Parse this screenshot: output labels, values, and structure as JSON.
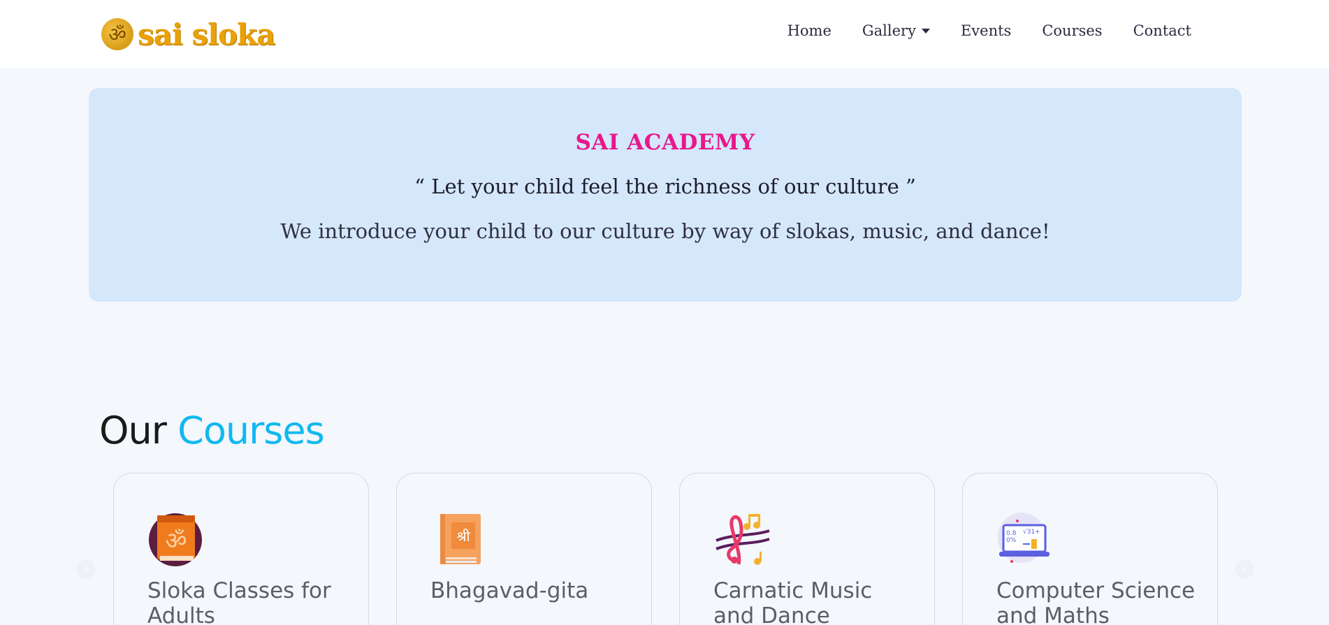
{
  "navbar": {
    "logo_text": "sai sloka",
    "logo_glyph": "ॐ",
    "links": [
      {
        "label": "Home"
      },
      {
        "label": "Gallery",
        "dropdown": true
      },
      {
        "label": "Events"
      },
      {
        "label": "Courses"
      },
      {
        "label": "Contact"
      }
    ]
  },
  "hero": {
    "title": "SAI ACADEMY",
    "quote": "“ Let your child feel the richness of our culture ”",
    "subtitle": "We introduce your child to our culture by way of slokas, music, and dance!"
  },
  "courses": {
    "heading_prefix": "Our",
    "heading_accent": "Courses",
    "items": [
      {
        "title": "Sloka Classes for Adults",
        "icon": "om-book-icon"
      },
      {
        "title": "Bhagavad-gita",
        "icon": "scripture-book-icon"
      },
      {
        "title": "Carnatic Music and Dance",
        "icon": "music-notes-icon"
      },
      {
        "title": "Computer Science and Maths",
        "icon": "laptop-math-icon"
      }
    ],
    "prev_arrow": "‹",
    "next_arrow": "›"
  },
  "colors": {
    "hero_bg": "#d5e7fb",
    "hero_title": "#e8178a",
    "accent": "#10b9ef",
    "logo": "#e9a106"
  }
}
